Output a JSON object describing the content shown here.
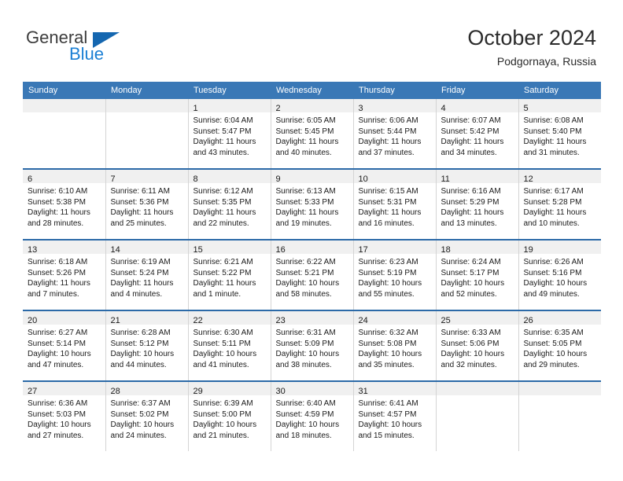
{
  "brand": {
    "name_top": "General",
    "name_bottom": "Blue",
    "triangle_color": "#1567b0",
    "top_color": "#3c3c3c",
    "bottom_color": "#1b7fd4"
  },
  "header": {
    "title": "October 2024",
    "subtitle": "Podgornaya, Russia"
  },
  "colors": {
    "header_blue": "#3a78b6",
    "row_divider_blue": "#2c6aa8",
    "daynum_band": "#f0f0f0",
    "cell_border": "#d4d4d4",
    "text": "#1a1a1a"
  },
  "weekday_headers": [
    "Sunday",
    "Monday",
    "Tuesday",
    "Wednesday",
    "Thursday",
    "Friday",
    "Saturday"
  ],
  "weeks": [
    [
      {
        "day": "",
        "lines": []
      },
      {
        "day": "",
        "lines": []
      },
      {
        "day": "1",
        "lines": [
          "Sunrise: 6:04 AM",
          "Sunset: 5:47 PM",
          "Daylight: 11 hours",
          "and 43 minutes."
        ]
      },
      {
        "day": "2",
        "lines": [
          "Sunrise: 6:05 AM",
          "Sunset: 5:45 PM",
          "Daylight: 11 hours",
          "and 40 minutes."
        ]
      },
      {
        "day": "3",
        "lines": [
          "Sunrise: 6:06 AM",
          "Sunset: 5:44 PM",
          "Daylight: 11 hours",
          "and 37 minutes."
        ]
      },
      {
        "day": "4",
        "lines": [
          "Sunrise: 6:07 AM",
          "Sunset: 5:42 PM",
          "Daylight: 11 hours",
          "and 34 minutes."
        ]
      },
      {
        "day": "5",
        "lines": [
          "Sunrise: 6:08 AM",
          "Sunset: 5:40 PM",
          "Daylight: 11 hours",
          "and 31 minutes."
        ]
      }
    ],
    [
      {
        "day": "6",
        "lines": [
          "Sunrise: 6:10 AM",
          "Sunset: 5:38 PM",
          "Daylight: 11 hours",
          "and 28 minutes."
        ]
      },
      {
        "day": "7",
        "lines": [
          "Sunrise: 6:11 AM",
          "Sunset: 5:36 PM",
          "Daylight: 11 hours",
          "and 25 minutes."
        ]
      },
      {
        "day": "8",
        "lines": [
          "Sunrise: 6:12 AM",
          "Sunset: 5:35 PM",
          "Daylight: 11 hours",
          "and 22 minutes."
        ]
      },
      {
        "day": "9",
        "lines": [
          "Sunrise: 6:13 AM",
          "Sunset: 5:33 PM",
          "Daylight: 11 hours",
          "and 19 minutes."
        ]
      },
      {
        "day": "10",
        "lines": [
          "Sunrise: 6:15 AM",
          "Sunset: 5:31 PM",
          "Daylight: 11 hours",
          "and 16 minutes."
        ]
      },
      {
        "day": "11",
        "lines": [
          "Sunrise: 6:16 AM",
          "Sunset: 5:29 PM",
          "Daylight: 11 hours",
          "and 13 minutes."
        ]
      },
      {
        "day": "12",
        "lines": [
          "Sunrise: 6:17 AM",
          "Sunset: 5:28 PM",
          "Daylight: 11 hours",
          "and 10 minutes."
        ]
      }
    ],
    [
      {
        "day": "13",
        "lines": [
          "Sunrise: 6:18 AM",
          "Sunset: 5:26 PM",
          "Daylight: 11 hours",
          "and 7 minutes."
        ]
      },
      {
        "day": "14",
        "lines": [
          "Sunrise: 6:19 AM",
          "Sunset: 5:24 PM",
          "Daylight: 11 hours",
          "and 4 minutes."
        ]
      },
      {
        "day": "15",
        "lines": [
          "Sunrise: 6:21 AM",
          "Sunset: 5:22 PM",
          "Daylight: 11 hours",
          "and 1 minute."
        ]
      },
      {
        "day": "16",
        "lines": [
          "Sunrise: 6:22 AM",
          "Sunset: 5:21 PM",
          "Daylight: 10 hours",
          "and 58 minutes."
        ]
      },
      {
        "day": "17",
        "lines": [
          "Sunrise: 6:23 AM",
          "Sunset: 5:19 PM",
          "Daylight: 10 hours",
          "and 55 minutes."
        ]
      },
      {
        "day": "18",
        "lines": [
          "Sunrise: 6:24 AM",
          "Sunset: 5:17 PM",
          "Daylight: 10 hours",
          "and 52 minutes."
        ]
      },
      {
        "day": "19",
        "lines": [
          "Sunrise: 6:26 AM",
          "Sunset: 5:16 PM",
          "Daylight: 10 hours",
          "and 49 minutes."
        ]
      }
    ],
    [
      {
        "day": "20",
        "lines": [
          "Sunrise: 6:27 AM",
          "Sunset: 5:14 PM",
          "Daylight: 10 hours",
          "and 47 minutes."
        ]
      },
      {
        "day": "21",
        "lines": [
          "Sunrise: 6:28 AM",
          "Sunset: 5:12 PM",
          "Daylight: 10 hours",
          "and 44 minutes."
        ]
      },
      {
        "day": "22",
        "lines": [
          "Sunrise: 6:30 AM",
          "Sunset: 5:11 PM",
          "Daylight: 10 hours",
          "and 41 minutes."
        ]
      },
      {
        "day": "23",
        "lines": [
          "Sunrise: 6:31 AM",
          "Sunset: 5:09 PM",
          "Daylight: 10 hours",
          "and 38 minutes."
        ]
      },
      {
        "day": "24",
        "lines": [
          "Sunrise: 6:32 AM",
          "Sunset: 5:08 PM",
          "Daylight: 10 hours",
          "and 35 minutes."
        ]
      },
      {
        "day": "25",
        "lines": [
          "Sunrise: 6:33 AM",
          "Sunset: 5:06 PM",
          "Daylight: 10 hours",
          "and 32 minutes."
        ]
      },
      {
        "day": "26",
        "lines": [
          "Sunrise: 6:35 AM",
          "Sunset: 5:05 PM",
          "Daylight: 10 hours",
          "and 29 minutes."
        ]
      }
    ],
    [
      {
        "day": "27",
        "lines": [
          "Sunrise: 6:36 AM",
          "Sunset: 5:03 PM",
          "Daylight: 10 hours",
          "and 27 minutes."
        ]
      },
      {
        "day": "28",
        "lines": [
          "Sunrise: 6:37 AM",
          "Sunset: 5:02 PM",
          "Daylight: 10 hours",
          "and 24 minutes."
        ]
      },
      {
        "day": "29",
        "lines": [
          "Sunrise: 6:39 AM",
          "Sunset: 5:00 PM",
          "Daylight: 10 hours",
          "and 21 minutes."
        ]
      },
      {
        "day": "30",
        "lines": [
          "Sunrise: 6:40 AM",
          "Sunset: 4:59 PM",
          "Daylight: 10 hours",
          "and 18 minutes."
        ]
      },
      {
        "day": "31",
        "lines": [
          "Sunrise: 6:41 AM",
          "Sunset: 4:57 PM",
          "Daylight: 10 hours",
          "and 15 minutes."
        ]
      },
      {
        "day": "",
        "lines": []
      },
      {
        "day": "",
        "lines": []
      }
    ]
  ]
}
